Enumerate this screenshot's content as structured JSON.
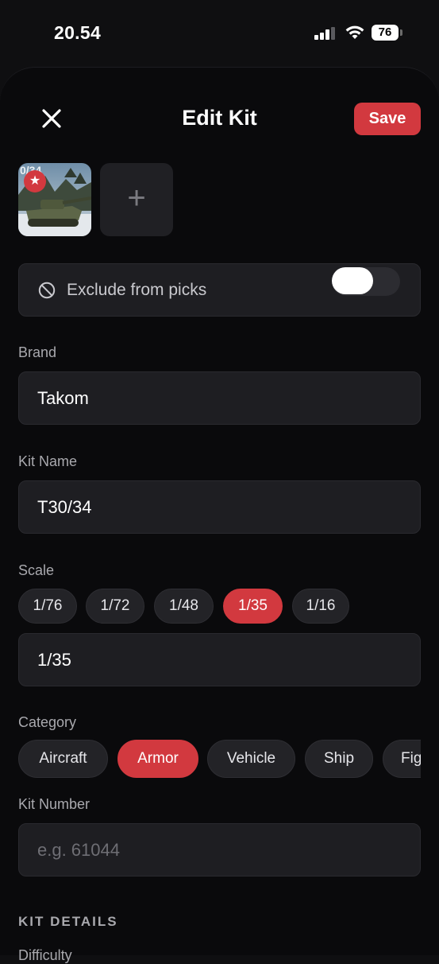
{
  "status_bar": {
    "time": "20.54",
    "battery": "76"
  },
  "header": {
    "title": "Edit Kit",
    "save_label": "Save"
  },
  "photos": {
    "add_symbol": "+"
  },
  "exclude": {
    "label": "Exclude from picks",
    "enabled": false
  },
  "brand": {
    "label": "Brand",
    "value": "Takom"
  },
  "kit_name": {
    "label": "Kit Name",
    "value": "T30/34"
  },
  "scale": {
    "label": "Scale",
    "options": [
      "1/76",
      "1/72",
      "1/48",
      "1/35",
      "1/16"
    ],
    "selected": "1/35",
    "value": "1/35"
  },
  "category": {
    "label": "Category",
    "options": [
      "Aircraft",
      "Armor",
      "Vehicle",
      "Ship",
      "Fig"
    ],
    "selected": "Armor"
  },
  "kit_number": {
    "label": "Kit Number",
    "placeholder": "e.g. 61044"
  },
  "sections": {
    "kit_details": "KIT DETAILS",
    "next_label": "Difficulty"
  },
  "colors": {
    "accent": "#d2393f",
    "background": "#0a0a0c",
    "field": "#1e1e22"
  },
  "icons": [
    "close-icon",
    "star-icon",
    "plus-icon",
    "ban-icon",
    "wifi-icon",
    "signal-icon",
    "battery-icon"
  ]
}
